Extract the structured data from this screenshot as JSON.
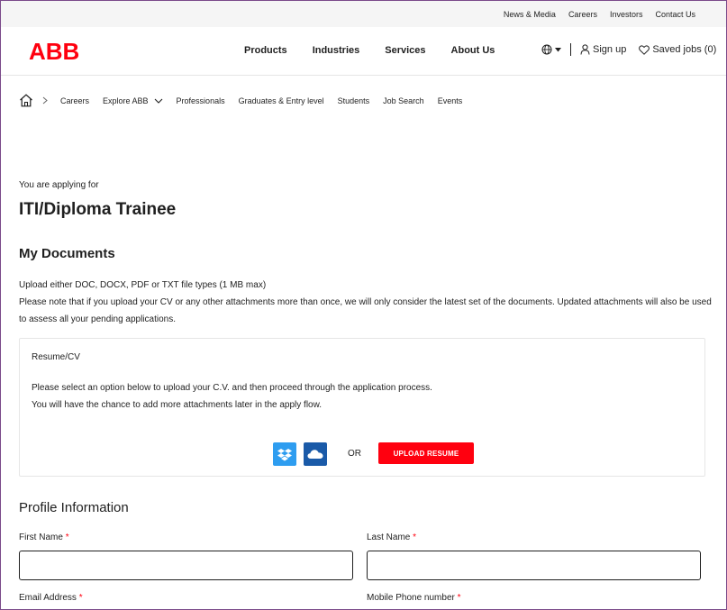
{
  "topbar": {
    "links": [
      "News & Media",
      "Careers",
      "Investors",
      "Contact Us"
    ]
  },
  "header": {
    "logo": "ABB",
    "brand_color": "#ff000f",
    "nav": [
      "Products",
      "Industries",
      "Services",
      "About Us"
    ],
    "globe_icon": "globe-icon",
    "sign_up": "Sign up",
    "saved_jobs": "Saved jobs (0)"
  },
  "breadcrumb": {
    "items": [
      "Careers",
      "Explore ABB",
      "Professionals",
      "Graduates & Entry level",
      "Students",
      "Job Search",
      "Events"
    ]
  },
  "job": {
    "applying_for": "You are applying for",
    "title": "ITI/Diploma Trainee"
  },
  "documents": {
    "heading": "My Documents",
    "file_types": "Upload either DOC, DOCX, PDF or TXT file types (1 MB max)",
    "note": "Please note that if you upload your CV or any other attachments more than once, we will only consider the latest set of the documents. Updated attachments will also be used to assess all your pending applications.",
    "resume": {
      "title": "Resume/CV",
      "line1": "Please select an option below to upload your C.V. and then proceed through the application process.",
      "line2": "You will have the chance to add more attachments later in the apply flow.",
      "or": "OR",
      "upload_button": "UPLOAD RESUME"
    }
  },
  "profile": {
    "heading": "Profile Information",
    "first_name_label": "First Name",
    "last_name_label": "Last Name",
    "email_label": "Email Address",
    "phone_label": "Mobile Phone number",
    "required_mark": "*",
    "first_name_value": "",
    "last_name_value": ""
  }
}
